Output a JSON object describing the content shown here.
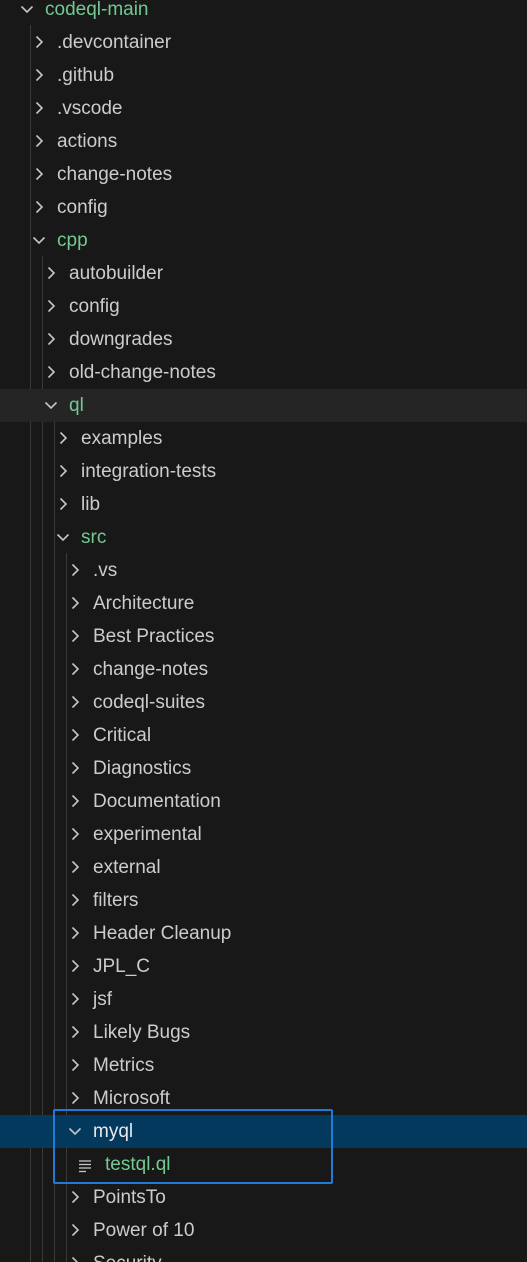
{
  "explorer": {
    "items": [
      {
        "label": "codeql-main",
        "type": "folder",
        "expanded": true,
        "depth": 0,
        "color": "green"
      },
      {
        "label": ".devcontainer",
        "type": "folder",
        "expanded": false,
        "depth": 1
      },
      {
        "label": ".github",
        "type": "folder",
        "expanded": false,
        "depth": 1
      },
      {
        "label": ".vscode",
        "type": "folder",
        "expanded": false,
        "depth": 1
      },
      {
        "label": "actions",
        "type": "folder",
        "expanded": false,
        "depth": 1
      },
      {
        "label": "change-notes",
        "type": "folder",
        "expanded": false,
        "depth": 1
      },
      {
        "label": "config",
        "type": "folder",
        "expanded": false,
        "depth": 1
      },
      {
        "label": "cpp",
        "type": "folder",
        "expanded": true,
        "depth": 1,
        "color": "green"
      },
      {
        "label": "autobuilder",
        "type": "folder",
        "expanded": false,
        "depth": 2
      },
      {
        "label": "config",
        "type": "folder",
        "expanded": false,
        "depth": 2
      },
      {
        "label": "downgrades",
        "type": "folder",
        "expanded": false,
        "depth": 2
      },
      {
        "label": "old-change-notes",
        "type": "folder",
        "expanded": false,
        "depth": 2
      },
      {
        "label": "ql",
        "type": "folder",
        "expanded": true,
        "depth": 2,
        "color": "green",
        "state": "hover"
      },
      {
        "label": "examples",
        "type": "folder",
        "expanded": false,
        "depth": 3
      },
      {
        "label": "integration-tests",
        "type": "folder",
        "expanded": false,
        "depth": 3
      },
      {
        "label": "lib",
        "type": "folder",
        "expanded": false,
        "depth": 3
      },
      {
        "label": "src",
        "type": "folder",
        "expanded": true,
        "depth": 3,
        "color": "green"
      },
      {
        "label": ".vs",
        "type": "folder",
        "expanded": false,
        "depth": 4
      },
      {
        "label": "Architecture",
        "type": "folder",
        "expanded": false,
        "depth": 4
      },
      {
        "label": "Best Practices",
        "type": "folder",
        "expanded": false,
        "depth": 4
      },
      {
        "label": "change-notes",
        "type": "folder",
        "expanded": false,
        "depth": 4
      },
      {
        "label": "codeql-suites",
        "type": "folder",
        "expanded": false,
        "depth": 4
      },
      {
        "label": "Critical",
        "type": "folder",
        "expanded": false,
        "depth": 4
      },
      {
        "label": "Diagnostics",
        "type": "folder",
        "expanded": false,
        "depth": 4
      },
      {
        "label": "Documentation",
        "type": "folder",
        "expanded": false,
        "depth": 4
      },
      {
        "label": "experimental",
        "type": "folder",
        "expanded": false,
        "depth": 4
      },
      {
        "label": "external",
        "type": "folder",
        "expanded": false,
        "depth": 4
      },
      {
        "label": "filters",
        "type": "folder",
        "expanded": false,
        "depth": 4
      },
      {
        "label": "Header Cleanup",
        "type": "folder",
        "expanded": false,
        "depth": 4
      },
      {
        "label": "JPL_C",
        "type": "folder",
        "expanded": false,
        "depth": 4
      },
      {
        "label": "jsf",
        "type": "folder",
        "expanded": false,
        "depth": 4
      },
      {
        "label": "Likely Bugs",
        "type": "folder",
        "expanded": false,
        "depth": 4
      },
      {
        "label": "Metrics",
        "type": "folder",
        "expanded": false,
        "depth": 4
      },
      {
        "label": "Microsoft",
        "type": "folder",
        "expanded": false,
        "depth": 4
      },
      {
        "label": "myql",
        "type": "folder",
        "expanded": true,
        "depth": 4,
        "color": "white",
        "state": "selected"
      },
      {
        "label": "testql.ql",
        "type": "file",
        "depth": 5,
        "color": "green",
        "icon": "file-lines-icon"
      },
      {
        "label": "PointsTo",
        "type": "folder",
        "expanded": false,
        "depth": 4
      },
      {
        "label": "Power of 10",
        "type": "folder",
        "expanded": false,
        "depth": 4
      },
      {
        "label": "Security",
        "type": "folder",
        "expanded": false,
        "depth": 4
      }
    ]
  },
  "colors": {
    "background": "#181818",
    "text": "#cccccc",
    "modified_green": "#73c991",
    "selection": "#04395e",
    "focus_border": "#1f7ad9",
    "hover": "#252526"
  }
}
